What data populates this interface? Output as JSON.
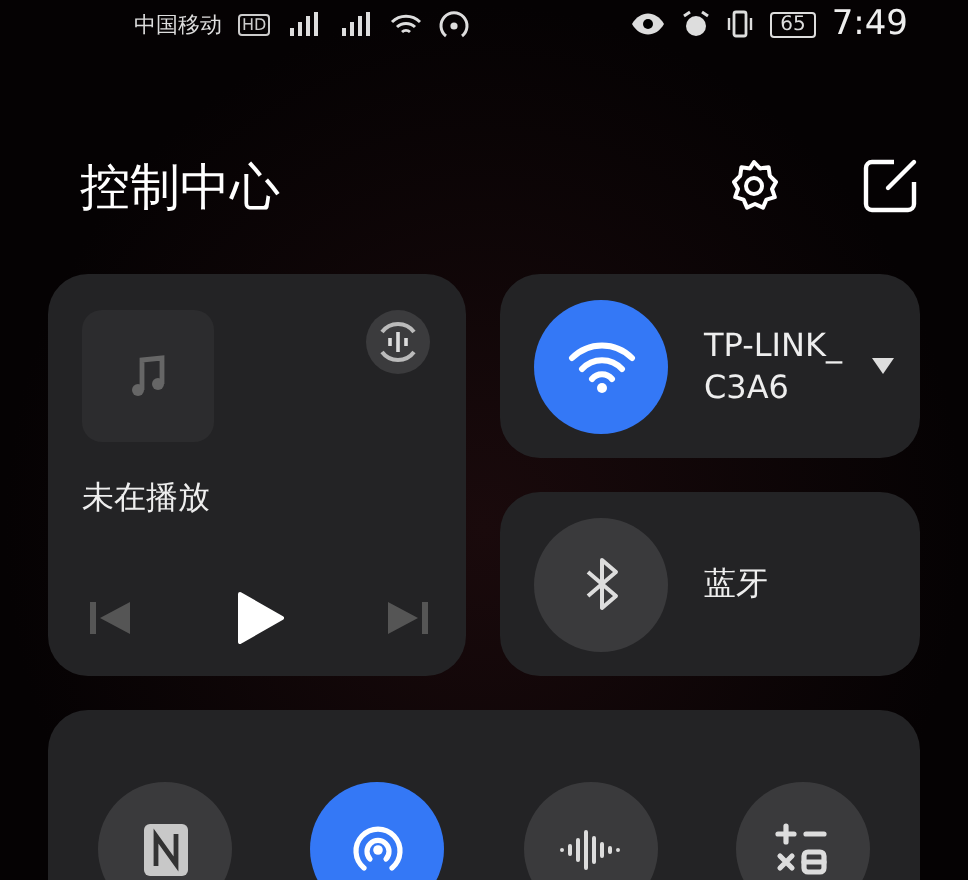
{
  "status_bar": {
    "carrier": "中国移动",
    "carrier_badge": "HD",
    "battery": "65",
    "time": "7:49"
  },
  "title": "控制中心",
  "media": {
    "status": "未在播放"
  },
  "wifi": {
    "name": "TP-LINK_C3A6",
    "on": true
  },
  "bluetooth": {
    "label": "蓝牙",
    "on": false
  },
  "toggles": [
    {
      "kind": "nfc",
      "on": false
    },
    {
      "kind": "hotspot",
      "on": true
    },
    {
      "kind": "sound",
      "on": false
    },
    {
      "kind": "calculator",
      "on": false
    }
  ]
}
